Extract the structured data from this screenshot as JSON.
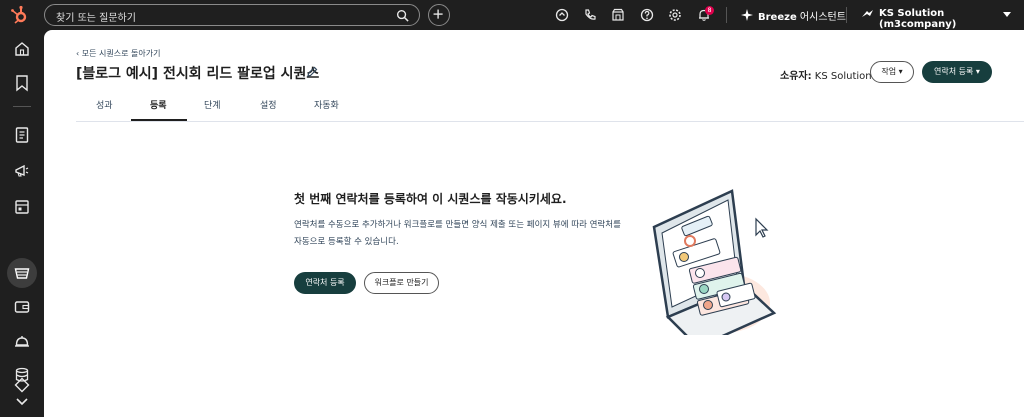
{
  "topbar": {
    "search_placeholder": "찾기 또는 질문하기",
    "notification_count": "8",
    "breeze_brand": "Breeze",
    "breeze_suffix": "어시스턴트",
    "account_name": "KS Solution (m3company)"
  },
  "page": {
    "back_link": "모든 시퀀스로 돌아가기",
    "title": "[블로그 예시] 전시회 리드 팔로업 시퀀스",
    "owner_label": "소유자:",
    "owner_name": "KS Solution",
    "action_button": "작업",
    "enroll_button": "연락처 등록"
  },
  "tabs": [
    {
      "label": "성과"
    },
    {
      "label": "등록"
    },
    {
      "label": "단계"
    },
    {
      "label": "설정"
    },
    {
      "label": "자동화"
    }
  ],
  "empty_state": {
    "title": "첫 번째 연락처를 등록하여 이 시퀀스를 작동시키세요.",
    "description": "연락처를 수동으로 추가하거나 워크플로를 만들면 양식 제출 또는 페이지 뷰에 따라 연락처를 자동으로 등록할 수 있습니다.",
    "primary_button": "연락처 등록",
    "secondary_button": "워크플로 만들기"
  },
  "colors": {
    "primary": "#173e3e",
    "topbar": "#1f1f1f",
    "badge": "#e0004d"
  }
}
